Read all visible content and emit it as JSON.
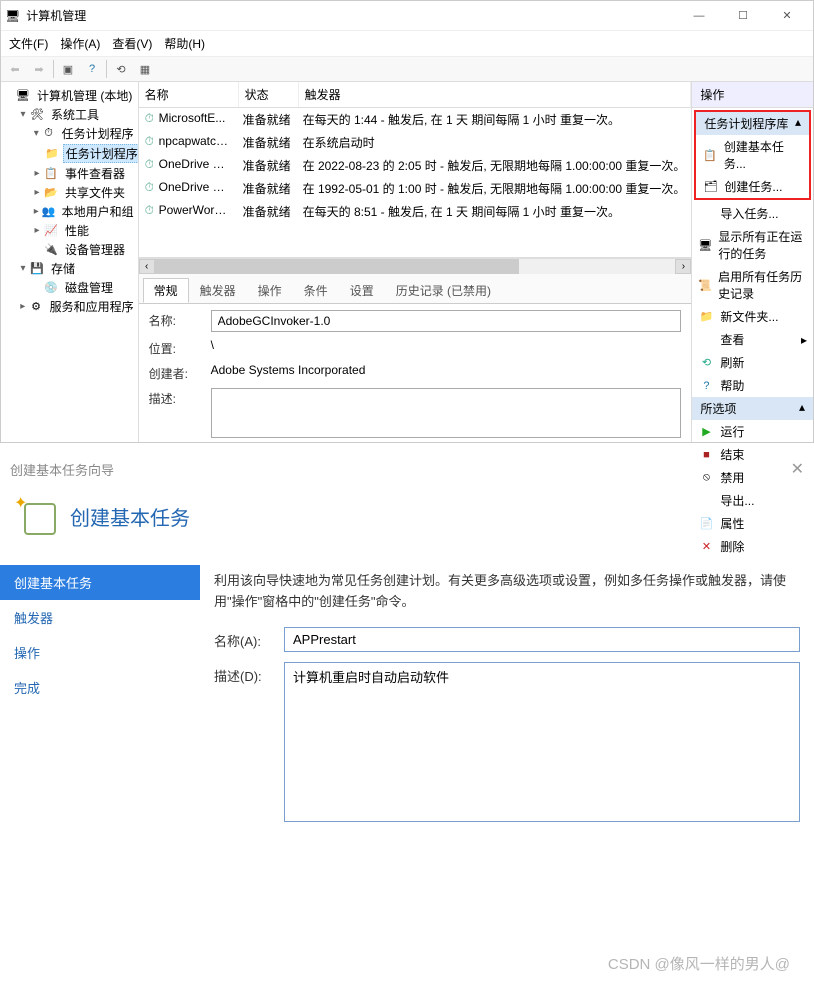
{
  "window": {
    "title": "计算机管理",
    "menus": [
      "文件(F)",
      "操作(A)",
      "查看(V)",
      "帮助(H)"
    ]
  },
  "tree": {
    "root": "计算机管理 (本地)",
    "sys_tools": "系统工具",
    "task_sched": "任务计划程序",
    "task_lib": "任务计划程序库",
    "event_viewer": "事件查看器",
    "shared_folders": "共享文件夹",
    "local_users": "本地用户和组",
    "performance": "性能",
    "device_mgr": "设备管理器",
    "storage": "存储",
    "disk_mgmt": "磁盘管理",
    "services_apps": "服务和应用程序"
  },
  "list": {
    "cols": {
      "name": "名称",
      "state": "状态",
      "trigger": "触发器"
    },
    "rows": [
      {
        "name": "MicrosoftE...",
        "state": "准备就绪",
        "trigger": "在每天的 1:44 - 触发后, 在 1 天 期间每隔 1 小时 重复一次。"
      },
      {
        "name": "npcapwatch...",
        "state": "准备就绪",
        "trigger": "在系统启动时"
      },
      {
        "name": "OneDrive R...",
        "state": "准备就绪",
        "trigger": "在 2022-08-23 的 2:05 时 - 触发后, 无限期地每隔 1.00:00:00 重复一次。"
      },
      {
        "name": "OneDrive St...",
        "state": "准备就绪",
        "trigger": "在 1992-05-01 的 1:00 时 - 触发后, 无限期地每隔 1.00:00:00 重复一次。"
      },
      {
        "name": "PowerWord...",
        "state": "准备就绪",
        "trigger": "在每天的 8:51 - 触发后, 在 1 天 期间每隔 1 小时 重复一次。"
      }
    ]
  },
  "tabs": [
    "常规",
    "触发器",
    "操作",
    "条件",
    "设置",
    "历史记录 (已禁用)"
  ],
  "details": {
    "labels": {
      "name": "名称:",
      "location": "位置:",
      "author": "创建者:",
      "desc": "描述:"
    },
    "name": "AdobeGCInvoker-1.0",
    "location": "\\",
    "author": "Adobe Systems Incorporated",
    "desc": ""
  },
  "actions": {
    "header": "操作",
    "lib_section": "任务计划程序库",
    "create_basic": "创建基本任务...",
    "create_task": "创建任务...",
    "import": "导入任务...",
    "show_running": "显示所有正在运行的任务",
    "enable_history": "启用所有任务历史记录",
    "new_folder": "新文件夹...",
    "view": "查看",
    "refresh": "刷新",
    "help": "帮助",
    "selected_section": "所选项",
    "run": "运行",
    "end": "结束",
    "disable": "禁用",
    "export": "导出...",
    "properties": "属性",
    "delete": "删除"
  },
  "wizard": {
    "bar_title": "创建基本任务向导",
    "heading": "创建基本任务",
    "nav": {
      "step1": "创建基本任务",
      "step2": "触发器",
      "step3": "操作",
      "step4": "完成"
    },
    "intro": "利用该向导快速地为常见任务创建计划。有关更多高级选项或设置，例如多任务操作或触发器，请使用\"操作\"窗格中的\"创建任务\"命令。",
    "labels": {
      "name": "名称(A):",
      "desc": "描述(D):"
    },
    "name_value": "APPrestart",
    "desc_value": "计算机重启时自动启动软件"
  },
  "watermark": "CSDN @像风一样的男人@"
}
